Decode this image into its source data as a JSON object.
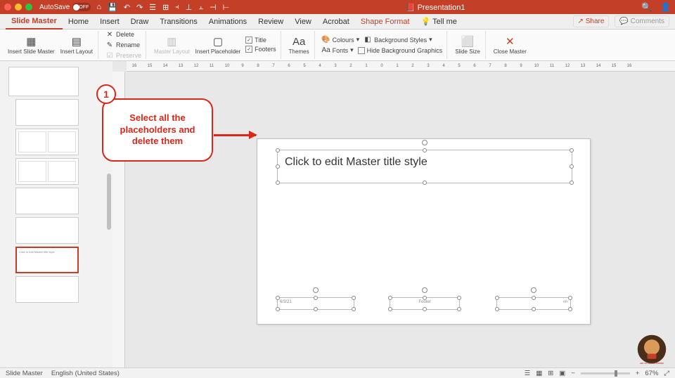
{
  "titlebar": {
    "autosave": "AutoSave",
    "autosave_state": "OFF",
    "title": "Presentation1"
  },
  "tabs": {
    "items": [
      "Slide Master",
      "Home",
      "Insert",
      "Draw",
      "Transitions",
      "Animations",
      "Review",
      "View",
      "Acrobat",
      "Shape Format"
    ],
    "tell_me": "Tell me",
    "share": "Share",
    "comments": "Comments"
  },
  "ribbon": {
    "insert_slide_master": "Insert Slide\nMaster",
    "insert_layout": "Insert\nLayout",
    "delete": "Delete",
    "rename": "Rename",
    "preserve": "Preserve",
    "master_layout": "Master\nLayout",
    "insert_placeholder": "Insert\nPlaceholder",
    "chk_title": "Title",
    "chk_footers": "Footers",
    "themes": "Themes",
    "colours": "Colours",
    "fonts": "Fonts",
    "bg_styles": "Background Styles",
    "hide_bg": "Hide Background Graphics",
    "slide_size": "Slide\nSize",
    "close_master": "Close\nMaster"
  },
  "canvas": {
    "title_text": "Click to edit Master title style",
    "date_text": "6/3/21",
    "footer_text": "Footer",
    "num_text": "‹#›"
  },
  "callout": {
    "number": "1",
    "text": "Select all the placeholders and delete them"
  },
  "status": {
    "view": "Slide Master",
    "lang": "English (United States)",
    "zoom": "67%"
  },
  "ruler_h": [
    "16",
    "15",
    "14",
    "13",
    "12",
    "11",
    "10",
    "9",
    "8",
    "7",
    "6",
    "5",
    "4",
    "3",
    "2",
    "1",
    "0",
    "1",
    "2",
    "3",
    "4",
    "5",
    "6",
    "7",
    "8",
    "9",
    "10",
    "11",
    "12",
    "13",
    "14",
    "15",
    "16"
  ]
}
